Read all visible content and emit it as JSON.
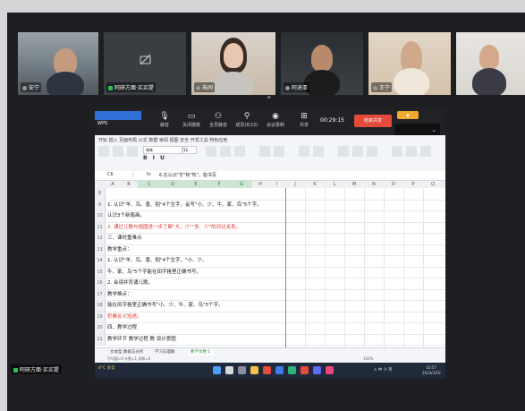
{
  "participants": [
    {
      "name": "安宁"
    },
    {
      "name": "阿研方面·买买提"
    },
    {
      "name": "朱同"
    },
    {
      "name": "阿迪亚"
    },
    {
      "name": "王宁"
    },
    {
      "name": ""
    }
  ],
  "meeting_toolbar": {
    "buttons": [
      "静音",
      "关闭摄像",
      "全员静音",
      "成员(8/10)",
      "会议录制",
      "共享"
    ],
    "timer": "00:29:15",
    "stop_share": "结束共享",
    "viewer": "共享者"
  },
  "spreadsheet": {
    "app_tab": "WPS",
    "menu_tabs": "开始  插入  页面布局  公式  数据  审阅  视图  安全  开发工具  特色应用",
    "font_name": "宋体",
    "font_size": "12",
    "cell_ref": "C6",
    "formula_fx": "fx",
    "formula_text": "6.在认识\"羊\"和\"牧\"，能书写",
    "columns": [
      "A",
      "B",
      "C",
      "D",
      "E",
      "F",
      "G",
      "H",
      "I",
      "J",
      "K",
      "L",
      "M",
      "N",
      "O",
      "P",
      "Q"
    ],
    "rows": [
      {
        "num": "8",
        "text": "",
        "red": false
      },
      {
        "num": "9",
        "text": "1. 认识\"羊、鸟、香、稻\"4个生字，会写\"小、少、牛、家、鸟\"5个字。",
        "red": false
      },
      {
        "num": "10",
        "text": "认识3个新笔画。",
        "red": false
      },
      {
        "num": "11",
        "text": "2. 通过儿歌与插图进一步了解\"大、少\"\"多、少\"的对比关系。",
        "red": true
      },
      {
        "num": "12",
        "text": "三、课时重难点",
        "red": false
      },
      {
        "num": "13",
        "text": "    教学重点：",
        "red": false
      },
      {
        "num": "14",
        "text": "1. 认识\"羊、鸟、香、稻\"4个生字，\"小、少、",
        "red": false
      },
      {
        "num": "15",
        "text": "牛、家、鸟\"5个字能在田字格里正确书写。",
        "red": false
      },
      {
        "num": "16",
        "text": "  2. 会读并背诵儿歌。",
        "red": false
      },
      {
        "num": "17",
        "text": "    教学难点：",
        "red": false
      },
      {
        "num": "18",
        "text": "能在田字格里正确书写\"小、少、牛、家、鸟\"5个字。",
        "red": false
      },
      {
        "num": "19",
        "text": "积累反义短语。",
        "red": true
      },
      {
        "num": "20",
        "text": "四、教学过程",
        "red": false
      },
      {
        "num": "21",
        "text": "教学环节      教学过程                    教              设计意图",
        "red": false
      }
    ],
    "sheet_tabs": [
      "文本型 数据与分析",
      "学习与理解",
      "教学文档 1"
    ],
    "status_left": "平均值=0  计数=1  求和=0",
    "zoom": "100%"
  },
  "taskbar": {
    "weather": "8°C 多云",
    "clock_time": "10:57",
    "clock_date": "2023/3/10",
    "tray": "∧  中  ⑦  英"
  },
  "bottom_name": "阿研方面·买买提"
}
